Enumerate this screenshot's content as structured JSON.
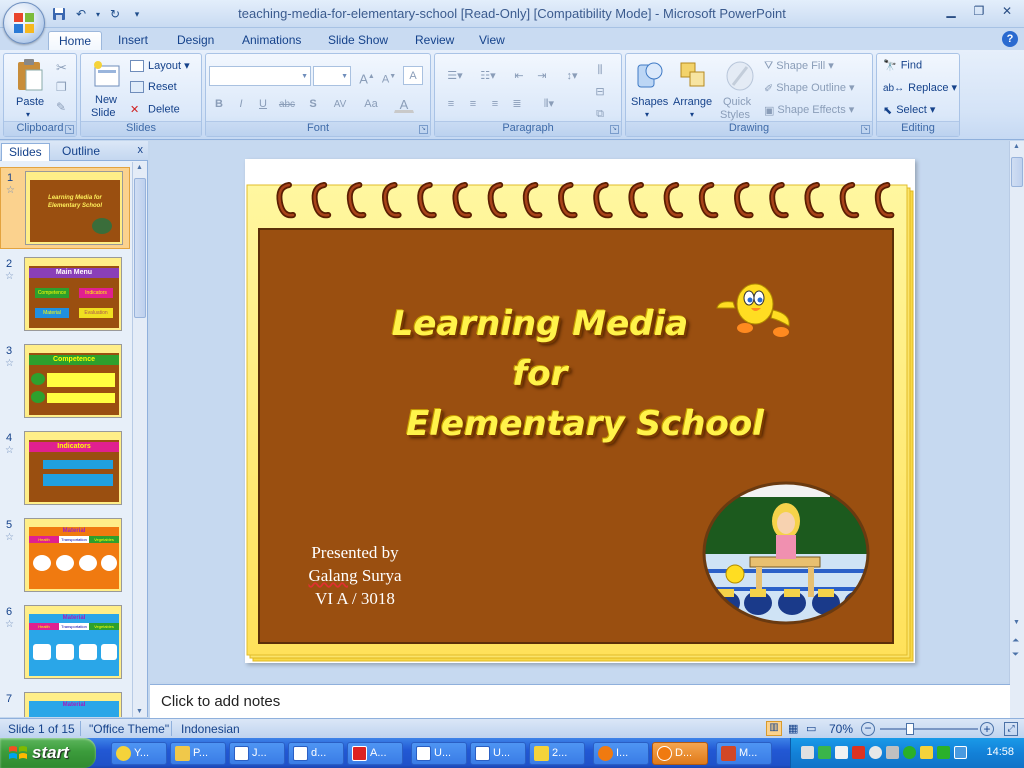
{
  "window": {
    "title": "teaching-media-for-elementary-school [Read-Only] [Compatibility Mode] - Microsoft PowerPoint"
  },
  "ribbon_tabs": [
    "Home",
    "Insert",
    "Design",
    "Animations",
    "Slide Show",
    "Review",
    "View"
  ],
  "groups": {
    "clipboard": {
      "label": "Clipboard",
      "paste": "Paste"
    },
    "slides": {
      "label": "Slides",
      "new_slide_line1": "New",
      "new_slide_line2": "Slide",
      "layout": "Layout",
      "reset": "Reset",
      "delete": "Delete"
    },
    "font": {
      "label": "Font",
      "bold": "B",
      "italic": "I",
      "underline": "U",
      "strike": "abc",
      "shadow": "S",
      "spacing": "AV",
      "case": "Aa",
      "color": "A"
    },
    "paragraph": {
      "label": "Paragraph"
    },
    "drawing": {
      "label": "Drawing",
      "shapes": "Shapes",
      "arrange": "Arrange",
      "quick_styles_line1": "Quick",
      "quick_styles_line2": "Styles",
      "shape_fill": "Shape Fill",
      "shape_outline": "Shape Outline",
      "shape_effects": "Shape Effects"
    },
    "editing": {
      "label": "Editing",
      "find": "Find",
      "replace": "Replace",
      "select": "Select"
    }
  },
  "pane": {
    "tab_slides": "Slides",
    "tab_outline": "Outline",
    "close": "x",
    "thumbnails": [
      {
        "num": "1",
        "star": "☆",
        "title": "Learning Media for Elementary School"
      },
      {
        "num": "2",
        "star": "☆",
        "title": "Main Menu",
        "buttons": [
          "Competence",
          "Indicators",
          "Material",
          "Evaluation"
        ]
      },
      {
        "num": "3",
        "star": "☆",
        "title": "Competence"
      },
      {
        "num": "4",
        "star": "☆",
        "title": "Indicators"
      },
      {
        "num": "5",
        "star": "☆",
        "title": "Material",
        "subtabs": [
          "Health",
          "Transportation",
          "Vegetables"
        ]
      },
      {
        "num": "6",
        "star": "☆",
        "title": "Material",
        "subtabs": [
          "Health",
          "Transportation",
          "Vegetables"
        ]
      },
      {
        "num": "7",
        "star": "",
        "title": "Material"
      }
    ]
  },
  "slide": {
    "title_line1": "Learning Media",
    "title_line2": "for",
    "title_line3": "Elementary School",
    "presented_by": "Presented by",
    "presenter_name_first": "Galang",
    "presenter_name_last": "Surya",
    "class_info": "VI A / 3018"
  },
  "notes": {
    "placeholder": "Click to add notes"
  },
  "status": {
    "slide_count": "Slide 1 of 15",
    "theme": "\"Office Theme\"",
    "language": "Indonesian",
    "zoom": "70%"
  },
  "taskbar": {
    "start": "start",
    "items": [
      "Y...",
      "P...",
      "J...",
      "d...",
      "A...",
      "U...",
      "U...",
      "2...",
      "I...",
      "D...",
      "M..."
    ],
    "clock": "14:58"
  },
  "colors": {
    "slide_brown": "#9a4f10",
    "slide_yellow": "#ffe978",
    "title_yellow": "#fff34a"
  }
}
